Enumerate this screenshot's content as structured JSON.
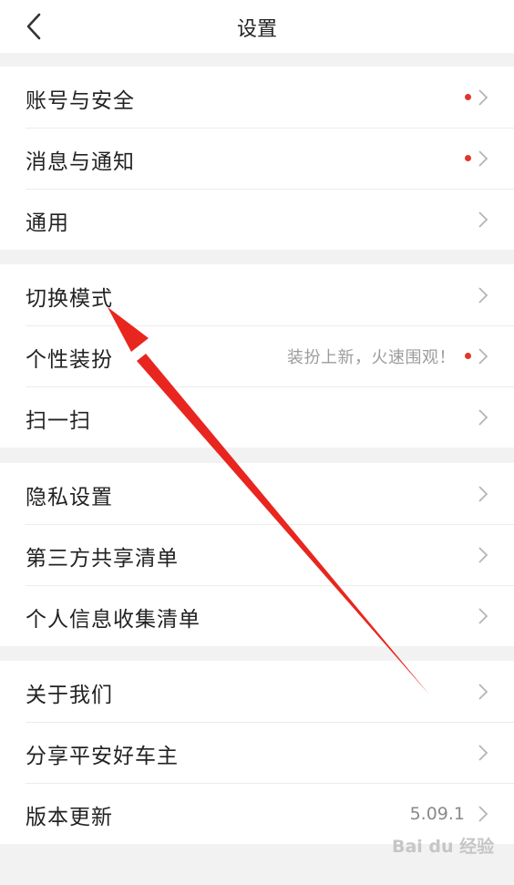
{
  "header": {
    "title": "设置",
    "back_icon": "chevron-left-icon"
  },
  "groups": [
    {
      "items": [
        {
          "label": "账号与安全",
          "dot": true
        },
        {
          "label": "消息与通知",
          "dot": true
        },
        {
          "label": "通用",
          "dot": false
        }
      ]
    },
    {
      "items": [
        {
          "label": "切换模式",
          "dot": false
        },
        {
          "label": "个性装扮",
          "hint": "装扮上新，火速围观！",
          "dot": true
        },
        {
          "label": "扫一扫",
          "dot": false
        }
      ]
    },
    {
      "items": [
        {
          "label": "隐私设置",
          "dot": false
        },
        {
          "label": "第三方共享清单",
          "dot": false
        },
        {
          "label": "个人信息收集清单",
          "dot": false
        }
      ]
    },
    {
      "items": [
        {
          "label": "关于我们",
          "dot": false
        },
        {
          "label": "分享平安好车主",
          "dot": false
        },
        {
          "label": "版本更新",
          "value": "5.09.1",
          "dot": false
        }
      ]
    }
  ],
  "colors": {
    "badge_dot": "#e0362c",
    "annotation_arrow": "#e8261f"
  },
  "watermark": "Bai du 经验"
}
